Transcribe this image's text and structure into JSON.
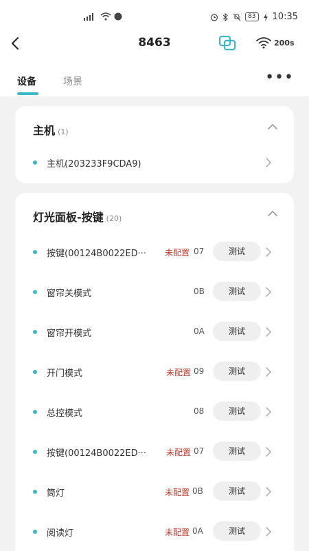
{
  "status": {
    "left_icons": "⁴⁶ ᵢₗₗ",
    "battery": "83",
    "time": "10:35"
  },
  "header": {
    "title": "8463",
    "wifi_label": "200s"
  },
  "tabs": [
    {
      "label": "设备"
    },
    {
      "label": "场景"
    }
  ],
  "more_label": "•••",
  "section_host": {
    "title": "主机",
    "count": "(1)",
    "rows": [
      {
        "name": "主机(203233F9CDA9)"
      }
    ]
  },
  "section_panel": {
    "title": "灯光面板-按键",
    "count": "(20)",
    "test_label": "测试",
    "rows": [
      {
        "name": "按键(00124B0022ED···",
        "status": "未配置",
        "code": "07"
      },
      {
        "name": "窗帘关模式",
        "status": "",
        "code": "0B"
      },
      {
        "name": "窗帘开模式",
        "status": "",
        "code": "0A"
      },
      {
        "name": "开门模式",
        "status": "未配置",
        "code": "09"
      },
      {
        "name": "总控模式",
        "status": "",
        "code": "08"
      },
      {
        "name": "按键(00124B0022ED···",
        "status": "未配置",
        "code": "07"
      },
      {
        "name": "筒灯",
        "status": "未配置",
        "code": "0B"
      },
      {
        "name": "阅读灯",
        "status": "未配置",
        "code": "0A"
      }
    ]
  },
  "colors": {
    "accent": "#3cb6c8",
    "warning": "#c0392b"
  }
}
